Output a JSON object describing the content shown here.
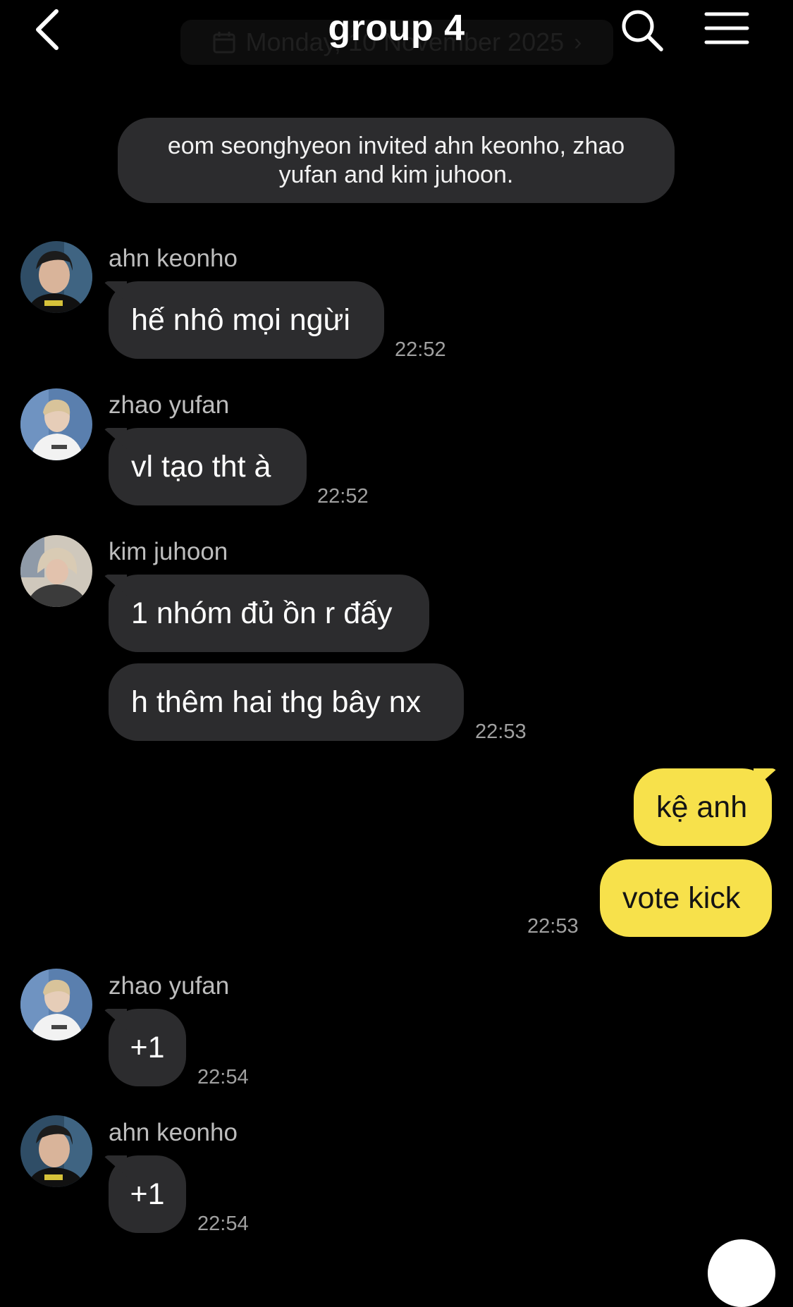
{
  "header": {
    "title": "group  4",
    "date_label": "Monday, 10 November 2025",
    "back_icon": "chevron-left-icon",
    "search_icon": "search-icon",
    "menu_icon": "hamburger-menu-icon"
  },
  "system_message": "eom seonghyeon invited ahn keonho, zhao yufan and kim juhoon.",
  "messages": [
    {
      "sender": "ahn keonho",
      "bubbles": [
        "hế nhô mọi ngừi"
      ],
      "time": "22:52"
    },
    {
      "sender": "zhao yufan",
      "bubbles": [
        "vl tạo tht à"
      ],
      "time": "22:52"
    },
    {
      "sender": "kim juhoon",
      "bubbles": [
        "1 nhóm đủ ồn r đấy",
        "h thêm hai thg bây nx"
      ],
      "time": "22:53"
    },
    {
      "sender": "me",
      "bubbles": [
        "kệ anh",
        "vote kick"
      ],
      "time": "22:53"
    },
    {
      "sender": "zhao yufan",
      "bubbles": [
        "+1"
      ],
      "time": "22:54"
    },
    {
      "sender": "ahn keonho",
      "bubbles": [
        "+1"
      ],
      "time": "22:54"
    }
  ],
  "colors": {
    "background": "#000000",
    "incoming_bubble": "#2c2c2e",
    "outgoing_bubble": "#f7e14b",
    "timestamp": "#a0a0a0"
  }
}
